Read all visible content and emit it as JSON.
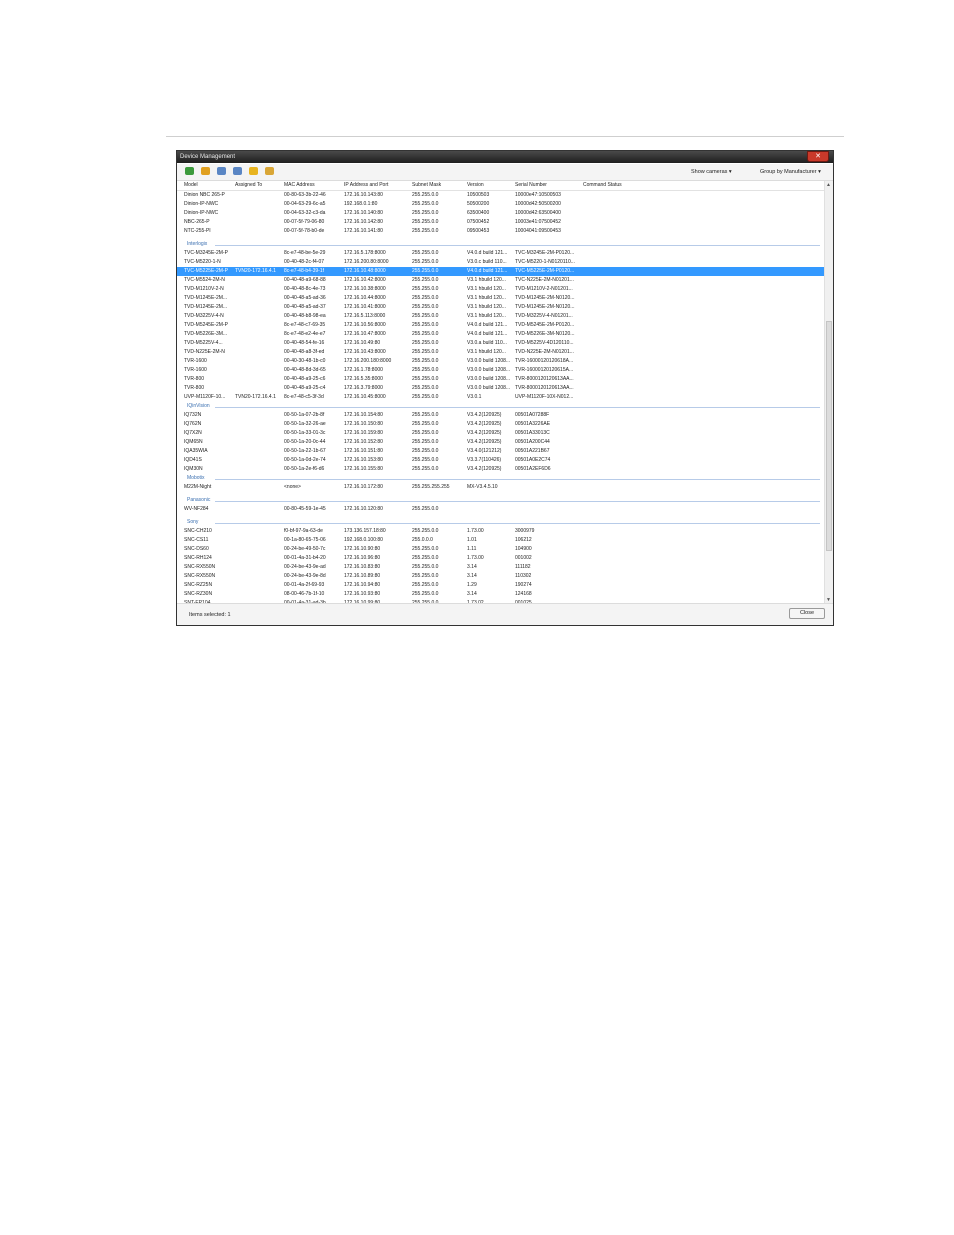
{
  "window": {
    "title": "Device Management",
    "close_glyph": "✕"
  },
  "toolbar": {
    "icons": [
      {
        "name": "refresh-icon",
        "color": "#3c9a3c"
      },
      {
        "name": "arrow-icon",
        "color": "#e0a020"
      },
      {
        "name": "window-icon",
        "color": "#5a86c4"
      },
      {
        "name": "properties-icon",
        "color": "#5a86c4"
      },
      {
        "name": "lightning-icon",
        "color": "#e8b420"
      },
      {
        "name": "key-icon",
        "color": "#d9a636"
      }
    ],
    "show_cameras": "Show cameras ▾",
    "group_by": "Group by Manufacturer ▾"
  },
  "columns": [
    "Model",
    "Assigned To",
    "MAC Address",
    "IP Address and Port",
    "Subnet Mask",
    "Version",
    "Serial Number",
    "Command Status"
  ],
  "rows": [
    {
      "t": "row",
      "c": [
        "Dinion NBC 265-P",
        "",
        "00-80-63-3b-22-46",
        "172.16.10.143:80",
        "255.255.0.0",
        "10500503",
        "10000e47:10500503",
        ""
      ]
    },
    {
      "t": "row",
      "c": [
        "Dinion-IP-NWC",
        "",
        "00-04-63-29-6c-a5",
        "192.168.0.1:80",
        "255.255.0.0",
        "50500200",
        "10000d42:50500200",
        ""
      ]
    },
    {
      "t": "row",
      "c": [
        "Dinion-IP-NWC",
        "",
        "00-04-63-32-c3-da",
        "172.16.10.140:80",
        "255.255.0.0",
        "63500400",
        "10000d42:63500400",
        ""
      ]
    },
    {
      "t": "row",
      "c": [
        "NBC-265-P",
        "",
        "00-07-5f-79-06-80",
        "172.16.10.142:80",
        "255.255.0.0",
        "07500452",
        "10003e41:07500452",
        ""
      ]
    },
    {
      "t": "row",
      "c": [
        "NTC-255-PI",
        "",
        "00-07-5f-78-b0-de",
        "172.16.10.141:80",
        "255.255.0.0",
        "09500453",
        "10004041:09500453",
        ""
      ]
    },
    {
      "t": "gap"
    },
    {
      "t": "group",
      "label": "Interlogix"
    },
    {
      "t": "row",
      "c": [
        "TVC-M3245E-2M-P",
        "",
        "8c-e7-48-be-5e-29",
        "172.16.5.178:8000",
        "255.255.0.0",
        "V4.0.d build 121...",
        "TVC-M3245E-2M-P0120...",
        ""
      ]
    },
    {
      "t": "row",
      "c": [
        "TVC-M5220-1-N",
        "",
        "00-40-48-2c-f4-07",
        "172.16.200.80:8000",
        "255.255.0.0",
        "V3.0.c build 110...",
        "TVC-M5220-1-N0120110...",
        ""
      ]
    },
    {
      "t": "row",
      "sel": true,
      "c": [
        "TVC-M5225E-2M-P",
        "TVN20-172.16.4.1",
        "8c-e7-48-b4-39-1f",
        "172.16.10.48:8000",
        "255.255.0.0",
        "V4.0.d build 121...",
        "TVC-M5225E-2M-P0120...",
        ""
      ]
    },
    {
      "t": "row",
      "c": [
        "TVC-M5524-2M-N",
        "",
        "00-40-48-a9-68-88",
        "172.16.10.42:8000",
        "255.255.0.0",
        "V3.1 hbuild 120...",
        "TVC-N225E-2M-N01201...",
        ""
      ]
    },
    {
      "t": "row",
      "c": [
        "TVD-M1210V-2-N",
        "",
        "00-40-48-8c-4e-73",
        "172.16.10.38:8000",
        "255.255.0.0",
        "V3.1 hbuild 120...",
        "TVD-M1210V-2-N01201...",
        ""
      ]
    },
    {
      "t": "row",
      "c": [
        "TVD-M1245E-2M...",
        "",
        "00-40-48-a5-ad-36",
        "172.16.10.44:8000",
        "255.255.0.0",
        "V3.1 hbuild 120...",
        "TVD-M1245E-2M-N0120...",
        ""
      ]
    },
    {
      "t": "row",
      "c": [
        "TVD-M1245E-2M...",
        "",
        "00-40-48-a5-ad-37",
        "172.16.10.41:8000",
        "255.255.0.0",
        "V3.1 hbuild 120...",
        "TVD-M1245E-2M-N0120...",
        ""
      ]
    },
    {
      "t": "row",
      "c": [
        "TVD-M3225V-4-N",
        "",
        "00-40-48-b8-98-ea",
        "172.16.5.113:8000",
        "255.255.0.0",
        "V3.1 hbuild 120...",
        "TVD-M3225V-4-N01201...",
        ""
      ]
    },
    {
      "t": "row",
      "c": [
        "TVD-M5245E-2M-P",
        "",
        "8c-e7-48-c7-69-35",
        "172.16.10.56:8000",
        "255.255.0.0",
        "V4.0.d build 121...",
        "TVD-M5245E-2M-P0120...",
        ""
      ]
    },
    {
      "t": "row",
      "c": [
        "TVD-M5226E-3M...",
        "",
        "8c-e7-48-e2-4e-e7",
        "172.16.10.47:8000",
        "255.255.0.0",
        "V4.0.d build 121...",
        "TVD-M5226E-3M-N0120...",
        ""
      ]
    },
    {
      "t": "row",
      "c": [
        "TVD-M5225V-4...",
        "",
        "00-40-48-54-fe-16",
        "172.16.10.49:80",
        "255.255.0.0",
        "V3.0.a build 110...",
        "TVD-M5225V-4D120110...",
        ""
      ]
    },
    {
      "t": "row",
      "c": [
        "TVD-N225E-2M-N",
        "",
        "00-40-48-a8-3f-ed",
        "172.16.10.43:8000",
        "255.255.0.0",
        "V3.1 hbuild 120...",
        "TVD-N225E-2M-N01201...",
        ""
      ]
    },
    {
      "t": "row",
      "c": [
        "TVR-1600",
        "",
        "00-40-30-48-1b-c0",
        "172.16.200.180:8000",
        "255.255.0.0",
        "V3.0.0 build 1208...",
        "TVR-16000120120618A...",
        ""
      ]
    },
    {
      "t": "row",
      "c": [
        "TVR-1600",
        "",
        "00-40-48-8d-3d-65",
        "172.16.1.78:8000",
        "255.255.0.0",
        "V3.0.0 build 1208...",
        "TVR-16000120120615A...",
        ""
      ]
    },
    {
      "t": "row",
      "c": [
        "TVR-800",
        "",
        "00-40-48-a9-25-c6",
        "172.16.5.35:8000",
        "255.255.0.0",
        "V3.0.0 build 1208...",
        "TVR-8000120120613AA...",
        ""
      ]
    },
    {
      "t": "row",
      "c": [
        "TVR-800",
        "",
        "00-40-48-a9-25-c4",
        "172.16.3.79:8000",
        "255.255.0.0",
        "V3.0.0 build 1208...",
        "TVR-8000120120613AA...",
        ""
      ]
    },
    {
      "t": "row",
      "c": [
        "UVP-M1120F-10...",
        "TVN20-172.16.4.1",
        "8c-e7-48-c5-3f-3d",
        "172.16.10.45:8000",
        "255.255.0.0",
        "V3.0.1",
        "UVP-M1120F-10X-N012...",
        ""
      ]
    },
    {
      "t": "group",
      "label": "IQinVision"
    },
    {
      "t": "row",
      "c": [
        "IQ732N",
        "",
        "00-50-1a-07-2b-8f",
        "172.16.10.154:80",
        "255.255.0.0",
        "V3.4.2(120925)",
        "00501A07288F",
        ""
      ]
    },
    {
      "t": "row",
      "c": [
        "IQ762N",
        "",
        "00-50-1a-32-26-ae",
        "172.16.10.150:80",
        "255.255.0.0",
        "V3.4.2(120925)",
        "00501A3226AE",
        ""
      ]
    },
    {
      "t": "row",
      "c": [
        "IQ7X2N",
        "",
        "00-50-1a-33-01-3c",
        "172.16.10.159:80",
        "255.255.0.0",
        "V3.4.2(120925)",
        "00501A33013C",
        ""
      ]
    },
    {
      "t": "row",
      "c": [
        "IQM65N",
        "",
        "00-50-1a-20-0c-44",
        "172.16.10.152:80",
        "255.255.0.0",
        "V3.4.2(120925)",
        "00501A200C44",
        ""
      ]
    },
    {
      "t": "row",
      "c": [
        "IQA35WIA",
        "",
        "00-50-1a-22-1b-67",
        "172.16.10.151:80",
        "255.255.0.0",
        "V3.4.0(121212)",
        "00501A221B67",
        ""
      ]
    },
    {
      "t": "row",
      "c": [
        "IQD41S",
        "",
        "00-50-1a-0d-2e-74",
        "172.16.10.153:80",
        "255.255.0.0",
        "V3.3.7(110426)",
        "00501A0E2C74",
        ""
      ]
    },
    {
      "t": "row",
      "c": [
        "IQM30N",
        "",
        "00-50-1a-2e-f6-d6",
        "172.16.10.155:80",
        "255.255.0.0",
        "V3.4.2(120925)",
        "00501A2EF6D6",
        ""
      ]
    },
    {
      "t": "group",
      "label": "Mobotix"
    },
    {
      "t": "row",
      "c": [
        "M22M-Night",
        "",
        "<none>",
        "172.16.10.172:80",
        "255.255.255.255",
        "MX-V3.4.5.10",
        "",
        ""
      ]
    },
    {
      "t": "gap"
    },
    {
      "t": "group",
      "label": "Panasonic"
    },
    {
      "t": "row",
      "c": [
        "WV-NF284",
        "",
        "00-80-45-59-1e-45",
        "172.16.10.120:80",
        "255.255.0.0",
        "",
        "",
        ""
      ]
    },
    {
      "t": "gap"
    },
    {
      "t": "group",
      "label": "Sony"
    },
    {
      "t": "row",
      "c": [
        "SNC-CH210",
        "",
        "f0-bf-97-9a-63-de",
        "173.136.157.18:80",
        "255.255.0.0",
        "1.73.00",
        "3000979",
        ""
      ]
    },
    {
      "t": "row",
      "c": [
        "SNC-CS11",
        "",
        "00-1a-80-65-75-06",
        "192.168.0.100:80",
        "255.0.0.0",
        "1.01",
        "106212",
        ""
      ]
    },
    {
      "t": "row",
      "c": [
        "SNC-DS60",
        "",
        "00-24-be-49-50-7c",
        "172.16.10.90:80",
        "255.255.0.0",
        "1.11",
        "104900",
        ""
      ]
    },
    {
      "t": "row",
      "c": [
        "SNC-RH124",
        "",
        "00-01-4a-31-b4-20",
        "172.16.10.96:80",
        "255.255.0.0",
        "1.73.00",
        "001002",
        ""
      ]
    },
    {
      "t": "row",
      "c": [
        "SNC-RX550N",
        "",
        "00-24-be-43-9e-ad",
        "172.16.10.83:80",
        "255.255.0.0",
        "3.14",
        "111182",
        ""
      ]
    },
    {
      "t": "row",
      "c": [
        "SNC-RX550N",
        "",
        "00-24-be-43-9e-8d",
        "172.16.10.89:80",
        "255.255.0.0",
        "3.14",
        "110302",
        ""
      ]
    },
    {
      "t": "row",
      "c": [
        "SNC-RZ25N",
        "",
        "00-01-4a-2f-69-93",
        "172.16.10.94:80",
        "255.255.0.0",
        "1.29",
        "190274",
        ""
      ]
    },
    {
      "t": "row",
      "c": [
        "SNC-RZ30N",
        "",
        "08-00-46-7b-1f-10",
        "172.16.10.93:80",
        "255.255.0.0",
        "3.14",
        "124168",
        ""
      ]
    },
    {
      "t": "row",
      "c": [
        "SNT-EP104",
        "",
        "00-01-4a-31-ad-3b",
        "172.16.10.99:80",
        "255.255.0.0",
        "1.73.02",
        "001025",
        ""
      ]
    }
  ],
  "status": {
    "items_selected": "Items selected: 1"
  },
  "buttons": {
    "close": "Close"
  },
  "colors": {
    "selection": "#3399ff",
    "group_label": "#3a6fb0"
  }
}
